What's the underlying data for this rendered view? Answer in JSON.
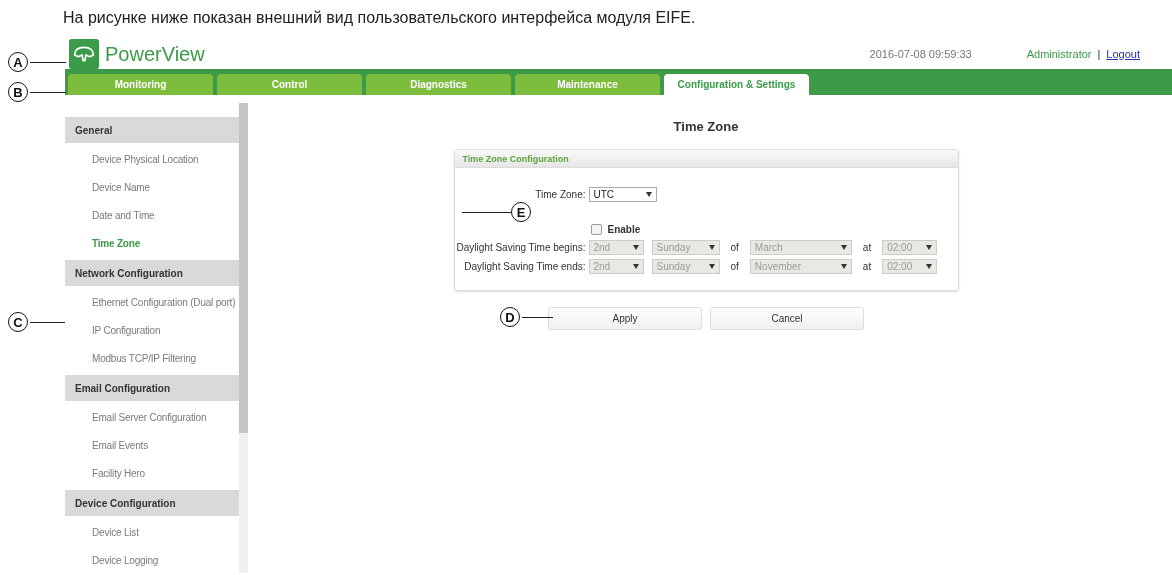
{
  "caption": "На рисунке ниже показан внешний вид пользовательского интерфейса модуля EIFE.",
  "header": {
    "callout": "A",
    "product": "PowerView",
    "datetime": "2016-07-08 09:59:33",
    "user": "Administrator",
    "separator": "|",
    "logout": "Logout"
  },
  "tabs": {
    "callout": "B",
    "items": [
      {
        "label": "Monitoring",
        "selected": false
      },
      {
        "label": "Control",
        "selected": false
      },
      {
        "label": "Diagnostics",
        "selected": false
      },
      {
        "label": "Maintenance",
        "selected": false
      },
      {
        "label": "Configuration & Settings",
        "selected": true
      }
    ]
  },
  "sidebar": {
    "callout": "C",
    "sections": [
      {
        "title": "General",
        "items": [
          {
            "label": "Device Physical Location",
            "selected": false
          },
          {
            "label": "Device Name",
            "selected": false
          },
          {
            "label": "Date and Time",
            "selected": false
          },
          {
            "label": "Time Zone",
            "selected": true
          }
        ]
      },
      {
        "title": "Network Configuration",
        "items": [
          {
            "label": "Ethernet Configuration (Dual port)",
            "selected": false
          },
          {
            "label": "IP Configuration",
            "selected": false
          },
          {
            "label": "Modbus TCP/IP Filtering",
            "selected": false
          }
        ]
      },
      {
        "title": "Email Configuration",
        "items": [
          {
            "label": "Email Server Configuration",
            "selected": false
          },
          {
            "label": "Email Events",
            "selected": false
          },
          {
            "label": "Facility Hero",
            "selected": false
          }
        ]
      },
      {
        "title": "Device Configuration",
        "items": [
          {
            "label": "Device List",
            "selected": false
          },
          {
            "label": "Device Logging",
            "selected": false
          }
        ]
      }
    ]
  },
  "page_title": "Time Zone",
  "panel": {
    "callout": "E",
    "title": "Time Zone Configuration",
    "fields": [
      {
        "kind": "select",
        "label": "Time Zone:",
        "value": "UTC",
        "disabled": false
      },
      {
        "kind": "checkbox",
        "label": "Enable",
        "checked": false
      },
      {
        "kind": "range",
        "label": "Daylight Saving Time begins:",
        "disabled": true,
        "parts": [
          {
            "kind": "select",
            "value": "2nd"
          },
          {
            "kind": "select",
            "value": "Sunday"
          },
          {
            "kind": "text",
            "value": "of"
          },
          {
            "kind": "select",
            "value": "March"
          },
          {
            "kind": "text",
            "value": "at"
          },
          {
            "kind": "select",
            "value": "02:00"
          }
        ]
      },
      {
        "kind": "range",
        "label": "Daylight Saving Time ends:",
        "disabled": true,
        "parts": [
          {
            "kind": "select",
            "value": "2nd"
          },
          {
            "kind": "select",
            "value": "Sunday"
          },
          {
            "kind": "text",
            "value": "of"
          },
          {
            "kind": "select",
            "value": "November"
          },
          {
            "kind": "text",
            "value": "at"
          },
          {
            "kind": "select",
            "value": "02:00"
          }
        ]
      }
    ]
  },
  "buttons": {
    "callout": "D",
    "items": [
      "Apply",
      "Cancel"
    ]
  }
}
